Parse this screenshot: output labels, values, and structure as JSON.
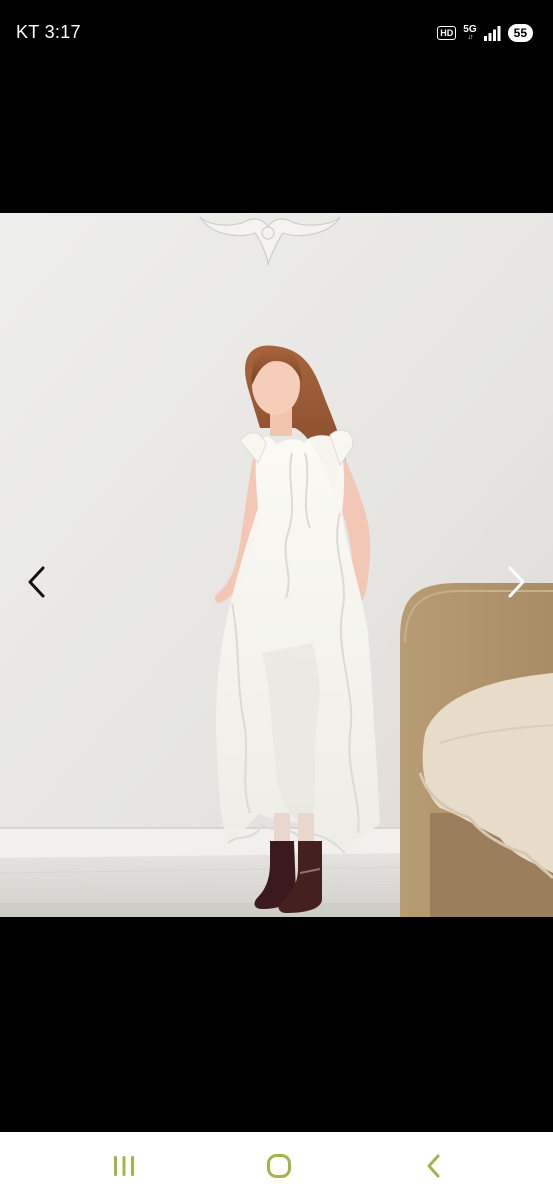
{
  "status_bar": {
    "time": "KT 3:17",
    "hd_label": "HD",
    "network_label": "5G",
    "network_arrows": "↓↑",
    "battery": "55"
  },
  "viewer": {
    "photo_icon": "product-photo-dress",
    "prev_icon": "chevron-left-icon",
    "next_icon": "chevron-right-icon"
  },
  "system_nav": {
    "recent_icon": "recent-apps-icon",
    "home_icon": "home-icon",
    "back_icon": "back-icon",
    "accent_color": "#a8b24a"
  }
}
